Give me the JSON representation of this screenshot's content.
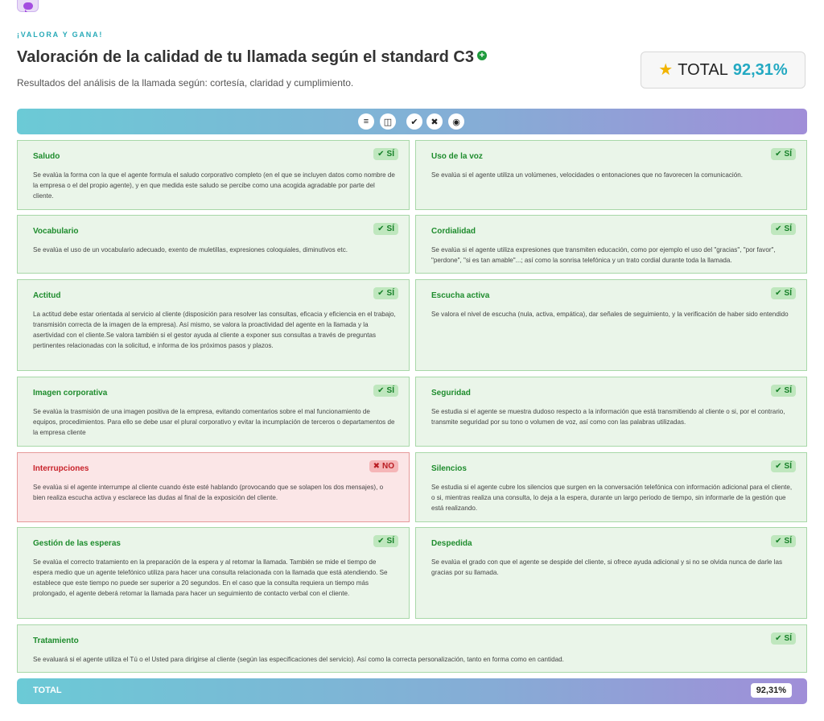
{
  "header": {
    "eyebrow": "¡VALORA Y GANA!",
    "title": "Valoración de la calidad de tu llamada según el standard C3",
    "subtitle": "Resultados del análisis de la llamada según: cortesía, claridad y cumplimiento.",
    "total_label": "TOTAL",
    "total_value": "92,31%"
  },
  "toolbar": {
    "icons": [
      "list-icon",
      "columns-icon",
      "check-icon",
      "close-icon",
      "eye-icon"
    ],
    "glyphs": [
      "≡",
      "◫",
      "✔",
      "✖",
      "◉"
    ]
  },
  "colors": {
    "accent": "#23a9c2",
    "pass_bg": "#eaf5e9",
    "pass_text": "#1e8c2d",
    "fail_bg": "#fbe6e7",
    "fail_text": "#c8232b",
    "gradient_start": "#6bcad6",
    "gradient_end": "#a08ed8"
  },
  "criteria": [
    {
      "title": "Saludo",
      "result": "SÍ",
      "status": "pass",
      "desc": "Se evalúa la forma con la que el agente formula el saludo corporativo completo (en el que se incluyen datos como nombre de la empresa o el del propio agente), y en que medida este saludo se percibe como una acogida agradable por parte del cliente."
    },
    {
      "title": "Uso de la voz",
      "result": "SÍ",
      "status": "pass",
      "desc": "Se evalúa si el agente utiliza un volúmenes, velocidades o entonaciones que no favorecen la comunicación."
    },
    {
      "title": "Vocabulario",
      "result": "SÍ",
      "status": "pass",
      "desc": "Se evalúa el uso de un vocabulario adecuado, exento de muletillas, expresiones coloquiales, diminutivos etc."
    },
    {
      "title": "Cordialidad",
      "result": "SÍ",
      "status": "pass",
      "desc": "Se evalúa si el agente utiliza expresiones que transmiten educación, como por ejemplo el uso del \"gracias\", \"por favor\", \"perdone\", \"si es tan amable\"...; así como la sonrisa telefónica y un trato cordial durante toda la llamada."
    },
    {
      "title": "Actitud",
      "result": "SÍ",
      "status": "pass",
      "desc": "La actitud debe estar orientada al servicio al cliente (disposición para resolver las consultas, eficacia y eficiencia en el trabajo, transmisión correcta de la imagen de la empresa). Así mismo, se valora la proactividad del agente en la llamada y la asertividad con el cliente.Se valora también si el gestor ayuda al cliente a exponer sus consultas a través de preguntas pertinentes relacionadas con la solicitud, e informa de los próximos pasos y plazos."
    },
    {
      "title": "Escucha activa",
      "result": "SÍ",
      "status": "pass",
      "desc": "Se valora el nivel de escucha (nula, activa, empática), dar señales de seguimiento, y la verificación de haber sido entendido"
    },
    {
      "title": "Imagen corporativa",
      "result": "SÍ",
      "status": "pass",
      "desc": "Se evalúa la trasmisión de una imagen positiva de la empresa, evitando comentarios sobre el mal funcionamiento de equipos, procedimientos. Para ello se debe usar el plural corporativo y evitar la incumplación de terceros o departamentos de la empresa cliente"
    },
    {
      "title": "Seguridad",
      "result": "SÍ",
      "status": "pass",
      "desc": "Se estudia si el agente se muestra dudoso respecto a la información que está transmitiendo al cliente o si, por el contrario, transmite seguridad por su tono o volumen de voz, así como con las palabras utilizadas."
    },
    {
      "title": "Interrupciones",
      "result": "NO",
      "status": "fail",
      "desc": "Se evalúa si el agente interrumpe al cliente cuando éste esté hablando (provocando que se solapen los dos mensajes), o bien realiza escucha activa y esclarece las dudas al final de la exposición del cliente."
    },
    {
      "title": "Silencios",
      "result": "SÍ",
      "status": "pass",
      "desc": "Se estudia si el agente cubre los silencios que surgen en la conversación telefónica con información adicional para el cliente, o si, mientras realiza una consulta, lo deja a la espera, durante un largo periodo de tiempo, sin informarle de la gestión que está realizando."
    },
    {
      "title": "Gestión de las esperas",
      "result": "SÍ",
      "status": "pass",
      "desc": "Se evalúa el correcto tratamiento en la preparación de la espera y al retomar la llamada. También se mide el tiempo de espera medio que un agente telefónico utiliza para hacer una consulta relacionada con la llamada que está atendiendo. Se establece que este tiempo no puede ser superior a 20 segundos. En el caso que la consulta requiera un tiempo más prolongado, el agente deberá retomar la llamada para hacer un seguimiento de contacto verbal con el cliente."
    },
    {
      "title": "Despedida",
      "result": "SÍ",
      "status": "pass",
      "desc": "Se evalúa el grado con que el agente se despide del cliente, si ofrece ayuda adicional y si no se olvida nunca de darle las gracias por su llamada."
    },
    {
      "title": "Tratamiento",
      "result": "SÍ",
      "status": "pass",
      "desc": "Se evaluará si el agente utiliza el Tú o el Usted para dirigirse al cliente (según las especificaciones del servicio). Así como la correcta personalización, tanto en forma como en cantidad."
    }
  ],
  "footer": {
    "label": "TOTAL",
    "value": "92,31%"
  }
}
